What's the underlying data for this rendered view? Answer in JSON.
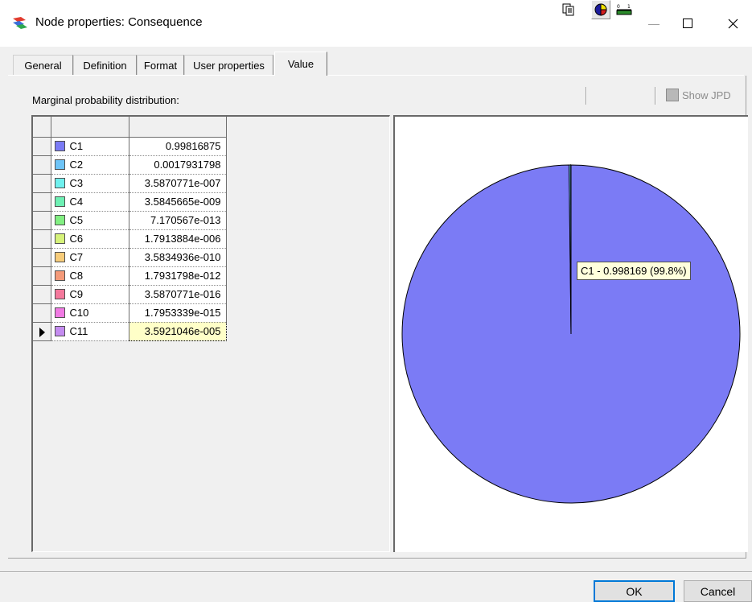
{
  "window": {
    "title": "Node properties: Consequence",
    "minimize_glyph": "—",
    "maximize_glyph": "☐",
    "close_glyph": "✕"
  },
  "tabs": [
    {
      "label": "General",
      "active": false
    },
    {
      "label": "Definition",
      "active": false
    },
    {
      "label": "Format",
      "active": false
    },
    {
      "label": "User properties",
      "active": false
    },
    {
      "label": "Value",
      "active": true
    }
  ],
  "panel": {
    "caption": "Marginal probability distribution:",
    "show_jpd_label": "Show JPD"
  },
  "toolbar": {
    "icons": [
      "copy-icon",
      "pie-chart-icon",
      "bar-chart-icon",
      "jpd-icon"
    ],
    "active": "pie-chart-icon"
  },
  "grid": {
    "selected_row": 10,
    "rows": [
      {
        "name": "C1",
        "value": "0.99816875",
        "color": "#7b7bf5"
      },
      {
        "name": "C2",
        "value": "0.0017931798",
        "color": "#6ec4f7"
      },
      {
        "name": "C3",
        "value": "3.5870771e-007",
        "color": "#6ff0ee"
      },
      {
        "name": "C4",
        "value": "3.5845665e-009",
        "color": "#6ef0b4"
      },
      {
        "name": "C5",
        "value": "7.170567e-013",
        "color": "#82ef82"
      },
      {
        "name": "C6",
        "value": "1.7913884e-006",
        "color": "#d6f27a"
      },
      {
        "name": "C7",
        "value": "3.5834936e-010",
        "color": "#f7cc7a"
      },
      {
        "name": "C8",
        "value": "1.7931798e-012",
        "color": "#f49a79"
      },
      {
        "name": "C9",
        "value": "3.5870771e-016",
        "color": "#f4799c"
      },
      {
        "name": "C10",
        "value": "1.7953339e-015",
        "color": "#f07ae3"
      },
      {
        "name": "C11",
        "value": "3.5921046e-005",
        "color": "#c48cf0"
      }
    ]
  },
  "chart_data": {
    "type": "pie",
    "categories": [
      "C1",
      "C2",
      "C3",
      "C4",
      "C5",
      "C6",
      "C7",
      "C8",
      "C9",
      "C10",
      "C11"
    ],
    "values": [
      0.99816875,
      0.0017931798,
      3.5870771e-07,
      3.5845665e-09,
      7.170567e-13,
      1.7913884e-06,
      3.5834936e-10,
      1.7931798e-12,
      3.5870771e-16,
      1.7953339e-15,
      3.5921046e-05
    ],
    "colors": [
      "#7b7bf5",
      "#6ec4f7",
      "#6ff0ee",
      "#6ef0b4",
      "#82ef82",
      "#d6f27a",
      "#f7cc7a",
      "#f49a79",
      "#f4799c",
      "#f07ae3",
      "#c48cf0"
    ],
    "tooltip": "C1 - 0.998169 (99.8%)"
  },
  "buttons": {
    "ok": "OK",
    "cancel": "Cancel"
  }
}
